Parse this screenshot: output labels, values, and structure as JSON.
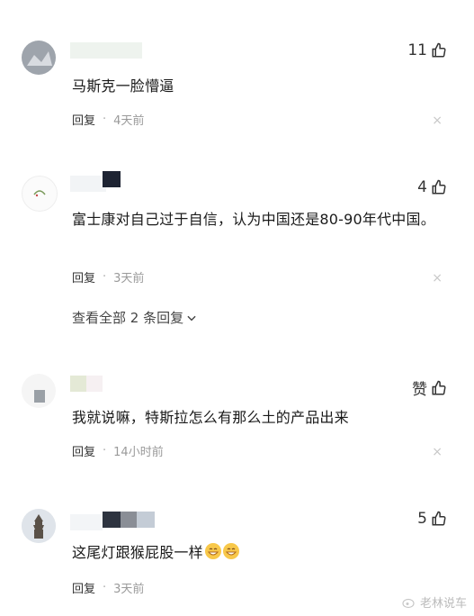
{
  "comments": [
    {
      "likes": "11",
      "text": "马斯克一脸懵逼",
      "reply": "回复",
      "time": "4天前"
    },
    {
      "likes": "4",
      "text": "富士康对自己过于自信，认为中国还是80-90年代中国。",
      "reply": "回复",
      "time": "3天前",
      "view_all": "查看全部 2 条回复"
    },
    {
      "likes": "赞",
      "text": "我就说嘛，特斯拉怎么有那么土的产品出来",
      "reply": "回复",
      "time": "14小时前"
    },
    {
      "likes": "5",
      "text": "这尾灯跟猴屁股一样",
      "reply": "回复",
      "time": "3天前"
    }
  ],
  "meta_separator": "·",
  "close_symbol": "×",
  "watermark": "老林说车",
  "emoji_name": "grinning-face-icon"
}
